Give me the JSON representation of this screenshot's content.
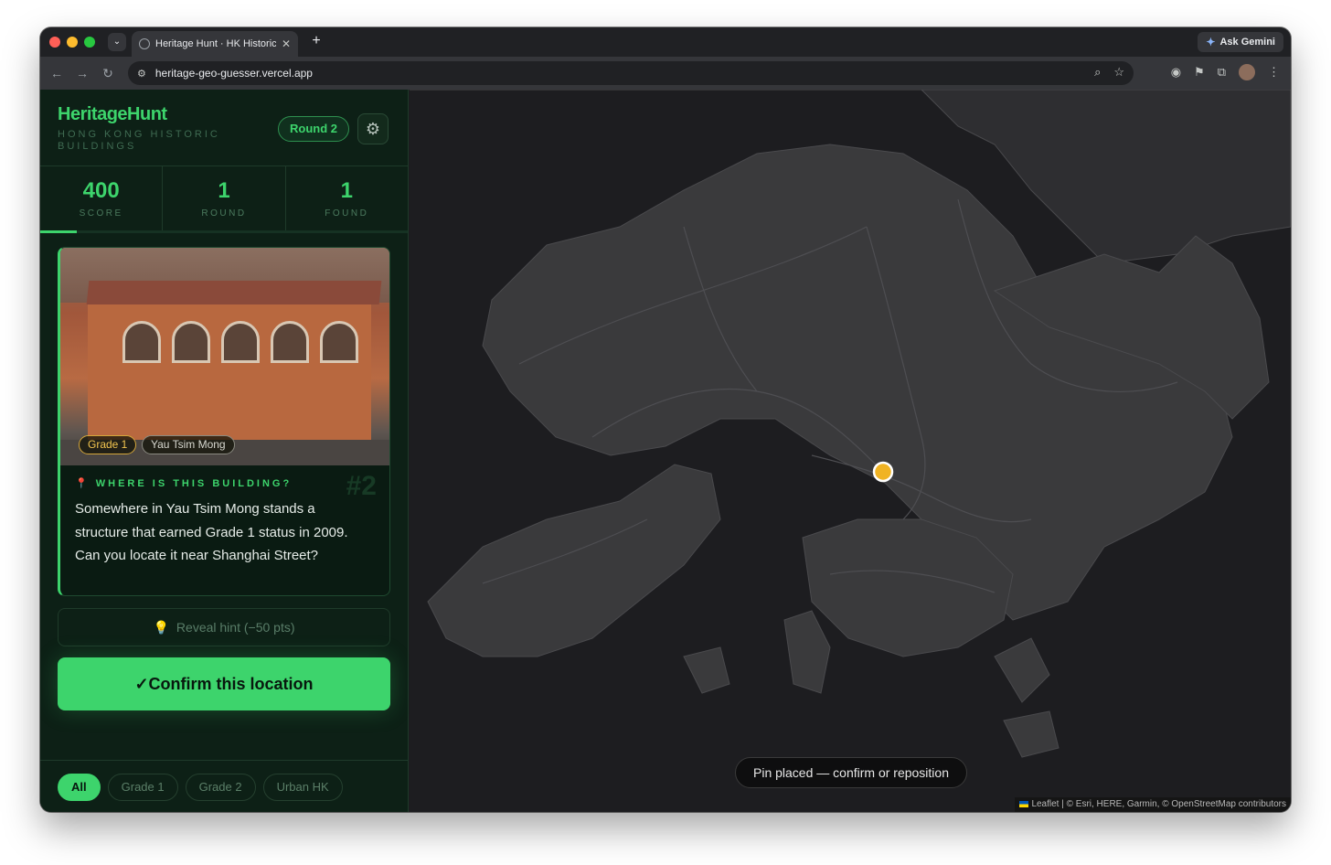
{
  "browser": {
    "tab_title": "Heritage Hunt · HK Historic B",
    "new_tab_label": "+",
    "gemini_label": "Ask Gemini",
    "url": "heritage-geo-guesser.vercel.app"
  },
  "app": {
    "title": "HeritageHunt",
    "subtitle": "HONG KONG HISTORIC BUILDINGS",
    "round_badge": "Round 2"
  },
  "stats": [
    {
      "value": "400",
      "label": "SCORE"
    },
    {
      "value": "1",
      "label": "ROUND"
    },
    {
      "value": "1",
      "label": "FOUND"
    }
  ],
  "progress": 0.1,
  "building": {
    "grade_tag": "Grade 1",
    "district_tag": "Yau Tsim Mong",
    "question_label": "WHERE IS THIS BUILDING?",
    "card_number": "#2",
    "question_text": "Somewhere in Yau Tsim Mong stands a structure that earned Grade 1 status in 2009. Can you locate it near Shanghai Street?"
  },
  "hint_button": "Reveal hint (−50 pts)",
  "confirm_button": "✓Confirm this location",
  "filters": [
    "All",
    "Grade 1",
    "Grade 2",
    "Urban HK"
  ],
  "map": {
    "toast": "Pin placed — confirm or reposition",
    "attribution_leaflet": "Leaflet",
    "attribution_rest": " | © Esri, HERE, Garmin, © OpenStreetMap contributors",
    "pin_color": "#f0b323"
  },
  "colors": {
    "accent": "#3dd46c",
    "sidebar_bg": "#0d2016",
    "map_land": "#3a3a3c",
    "map_water": "#1d1d20"
  }
}
